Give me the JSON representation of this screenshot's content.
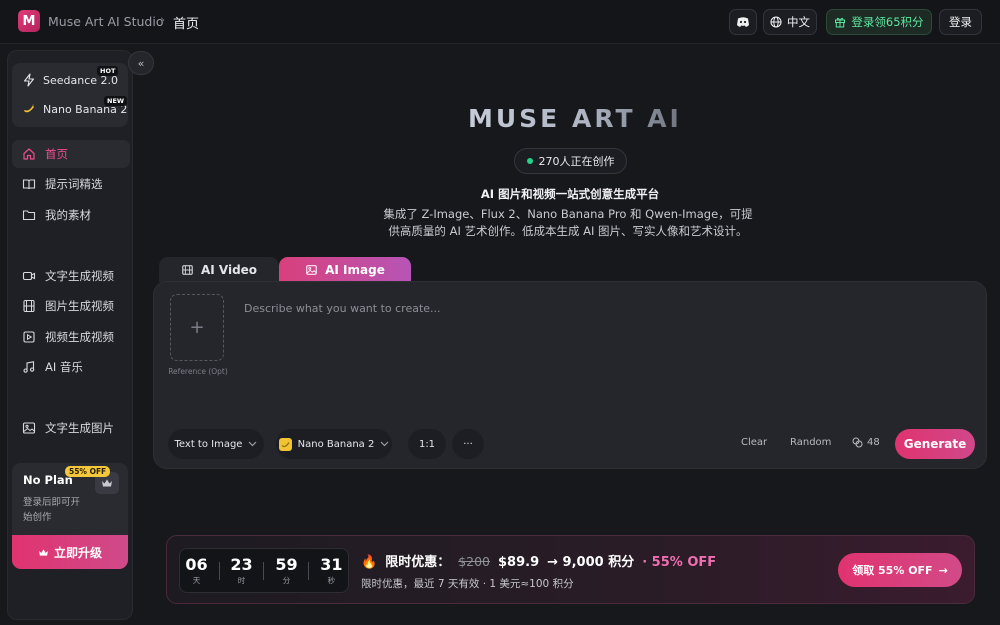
{
  "header": {
    "logo_letter": "M",
    "app_title": "Muse Art AI Studio",
    "breadcrumb_sep": "›",
    "breadcrumb_current": "首页",
    "language": "中文",
    "promo": "登录领65积分",
    "login": "登录"
  },
  "sidebar": {
    "collapse_glyph": "«",
    "models": [
      {
        "name": "Seedance 2.0",
        "badge": "HOT",
        "icon": "lightning-icon"
      },
      {
        "name": "Nano Banana 2",
        "badge": "NEW",
        "icon": "banana-icon"
      }
    ],
    "nav": [
      {
        "label": "首页",
        "icon": "home-icon",
        "active": true
      },
      {
        "label": "提示词精选",
        "icon": "book-icon"
      },
      {
        "label": "我的素材",
        "icon": "folder-icon"
      },
      {
        "label": "文字生成视频",
        "icon": "video-icon"
      },
      {
        "label": "图片生成视频",
        "icon": "film-icon"
      },
      {
        "label": "视频生成视频",
        "icon": "play-square-icon"
      },
      {
        "label": "AI 音乐",
        "icon": "music-icon"
      },
      {
        "label": "文字生成图片",
        "icon": "image-icon"
      }
    ],
    "plan": {
      "title": "No Plan",
      "desc": "登录后即可开始创作",
      "upgrade": "立即升级",
      "upgrade_badge": "55% OFF"
    }
  },
  "hero": {
    "title_part1": "MUSE ",
    "title_part2": "ART AI",
    "live": "270人正在创作",
    "tagline": "AI 图片和视频一站式创意生成平台",
    "desc": "集成了 Z-Image、Flux 2、Nano Banana Pro 和 Qwen-Image，可提供高质量的 AI 艺术创作。低成本生成 AI 图片、写实人像和艺术设计。"
  },
  "tabs": {
    "video": "AI Video",
    "image": "AI Image",
    "active": "image"
  },
  "composer": {
    "ref_plus": "+",
    "ref_label": "Reference (Opt)",
    "placeholder": "Describe what you want to create...",
    "value": "",
    "mode": "Text to Image",
    "model": "Nano Banana 2",
    "ratio": "1:1",
    "more": "···",
    "clear": "Clear",
    "random": "Random",
    "credits": "48",
    "generate": "Generate"
  },
  "offer": {
    "countdown": [
      {
        "value": "06",
        "label": "天"
      },
      {
        "value": "23",
        "label": "时"
      },
      {
        "value": "59",
        "label": "分"
      },
      {
        "value": "31",
        "label": "秒"
      }
    ],
    "fire": "🔥",
    "headline": "限时优惠：",
    "old_price": "$200",
    "new_price": "$89.9",
    "points": "→ 9,000 积分",
    "discount": "· 55% OFF",
    "subline": "限时优惠，最近 7 天有效 · 1 美元≈100 积分",
    "claim": "领取 55% OFF",
    "claim_arrow": "→"
  },
  "colors": {
    "accent": "#e0336f",
    "accent_text": "#ef4d8e",
    "live_dot": "#22d38a",
    "promo_green": "#5ee6a0",
    "background": "#17181c"
  }
}
